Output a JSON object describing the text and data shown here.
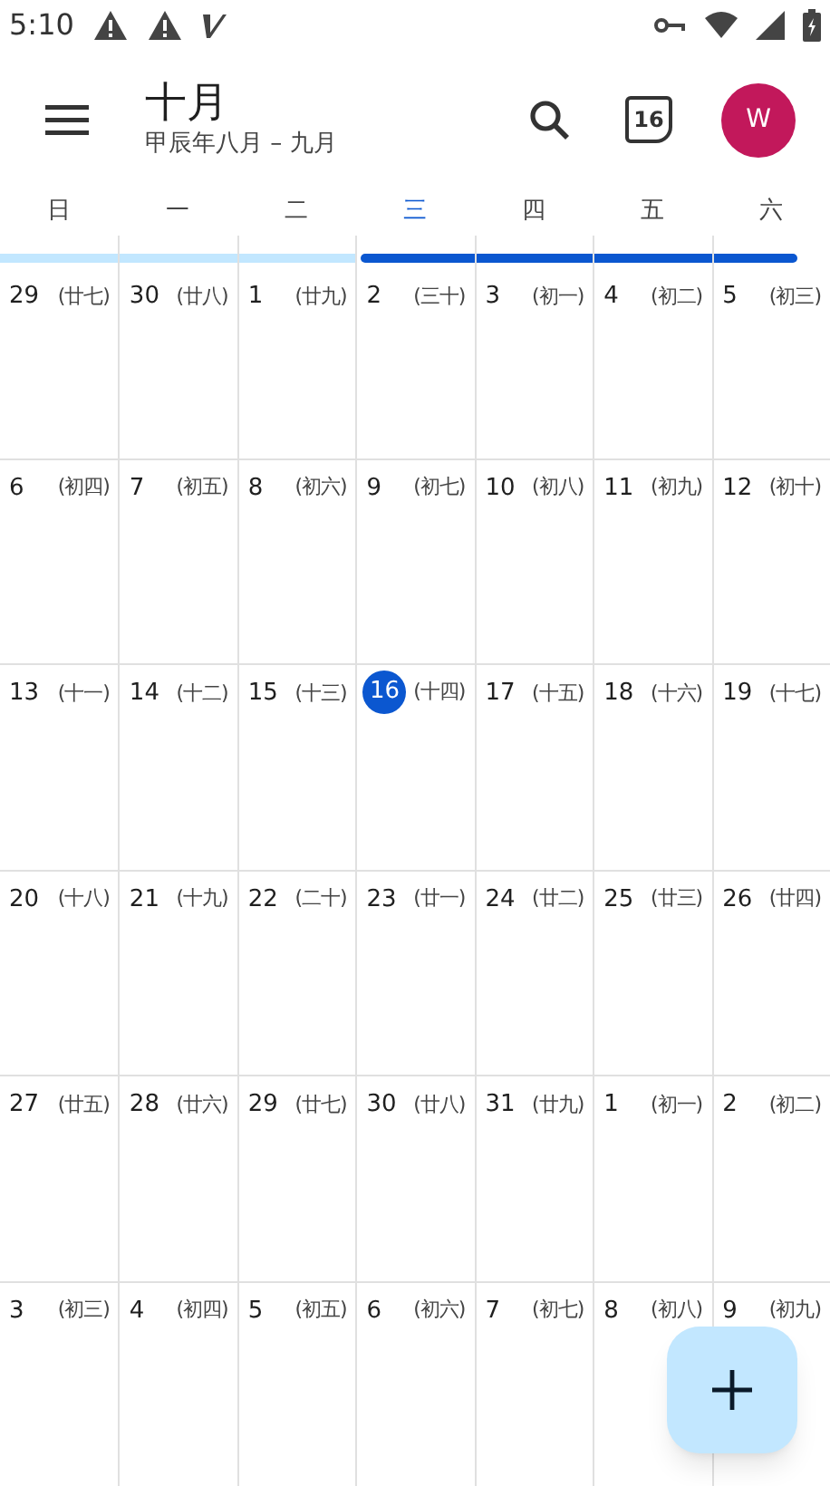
{
  "status_bar": {
    "time": "5:10"
  },
  "header": {
    "title": "十月",
    "subtitle": "甲辰年八月 – 九月",
    "today_button": "16",
    "avatar": "W"
  },
  "weekdays": [
    {
      "label": "日",
      "selected": false
    },
    {
      "label": "一",
      "selected": false
    },
    {
      "label": "二",
      "selected": false
    },
    {
      "label": "三",
      "selected": true
    },
    {
      "label": "四",
      "selected": false
    },
    {
      "label": "五",
      "selected": false
    },
    {
      "label": "六",
      "selected": false
    }
  ],
  "weeks": [
    [
      {
        "day": "29",
        "lunar": "(廿七)",
        "today": false,
        "color": "#c2e7ff"
      },
      {
        "day": "30",
        "lunar": "(廿八)",
        "today": false,
        "color": "#c2e7ff"
      },
      {
        "day": "1",
        "lunar": "(廿九)",
        "today": false,
        "color": "#c2e7ff"
      },
      {
        "day": "2",
        "lunar": "(三十)",
        "today": false,
        "color": "#0b57d0"
      },
      {
        "day": "3",
        "lunar": "(初一)",
        "today": false,
        "color": "#0b57d0"
      },
      {
        "day": "4",
        "lunar": "(初二)",
        "today": false,
        "color": "#0b57d0"
      },
      {
        "day": "5",
        "lunar": "(初三)",
        "today": false,
        "color": "#0b57d0"
      }
    ],
    [
      {
        "day": "6",
        "lunar": "(初四)",
        "today": false
      },
      {
        "day": "7",
        "lunar": "(初五)",
        "today": false
      },
      {
        "day": "8",
        "lunar": "(初六)",
        "today": false
      },
      {
        "day": "9",
        "lunar": "(初七)",
        "today": false
      },
      {
        "day": "10",
        "lunar": "(初八)",
        "today": false
      },
      {
        "day": "11",
        "lunar": "(初九)",
        "today": false
      },
      {
        "day": "12",
        "lunar": "(初十)",
        "today": false
      }
    ],
    [
      {
        "day": "13",
        "lunar": "(十一)",
        "today": false
      },
      {
        "day": "14",
        "lunar": "(十二)",
        "today": false
      },
      {
        "day": "15",
        "lunar": "(十三)",
        "today": false
      },
      {
        "day": "16",
        "lunar": "(十四)",
        "today": true
      },
      {
        "day": "17",
        "lunar": "(十五)",
        "today": false
      },
      {
        "day": "18",
        "lunar": "(十六)",
        "today": false
      },
      {
        "day": "19",
        "lunar": "(十七)",
        "today": false
      }
    ],
    [
      {
        "day": "20",
        "lunar": "(十八)",
        "today": false
      },
      {
        "day": "21",
        "lunar": "(十九)",
        "today": false
      },
      {
        "day": "22",
        "lunar": "(二十)",
        "today": false
      },
      {
        "day": "23",
        "lunar": "(廿一)",
        "today": false
      },
      {
        "day": "24",
        "lunar": "(廿二)",
        "today": false
      },
      {
        "day": "25",
        "lunar": "(廿三)",
        "today": false
      },
      {
        "day": "26",
        "lunar": "(廿四)",
        "today": false
      }
    ],
    [
      {
        "day": "27",
        "lunar": "(廿五)",
        "today": false
      },
      {
        "day": "28",
        "lunar": "(廿六)",
        "today": false
      },
      {
        "day": "29",
        "lunar": "(廿七)",
        "today": false
      },
      {
        "day": "30",
        "lunar": "(廿八)",
        "today": false
      },
      {
        "day": "31",
        "lunar": "(廿九)",
        "today": false
      },
      {
        "day": "1",
        "lunar": "(初一)",
        "today": false
      },
      {
        "day": "2",
        "lunar": "(初二)",
        "today": false
      }
    ],
    [
      {
        "day": "3",
        "lunar": "(初三)",
        "today": false
      },
      {
        "day": "4",
        "lunar": "(初四)",
        "today": false
      },
      {
        "day": "5",
        "lunar": "(初五)",
        "today": false
      },
      {
        "day": "6",
        "lunar": "(初六)",
        "today": false
      },
      {
        "day": "7",
        "lunar": "(初七)",
        "today": false
      },
      {
        "day": "8",
        "lunar": "(初八)",
        "today": false
      },
      {
        "day": "9",
        "lunar": "(初九)",
        "today": false
      }
    ]
  ]
}
